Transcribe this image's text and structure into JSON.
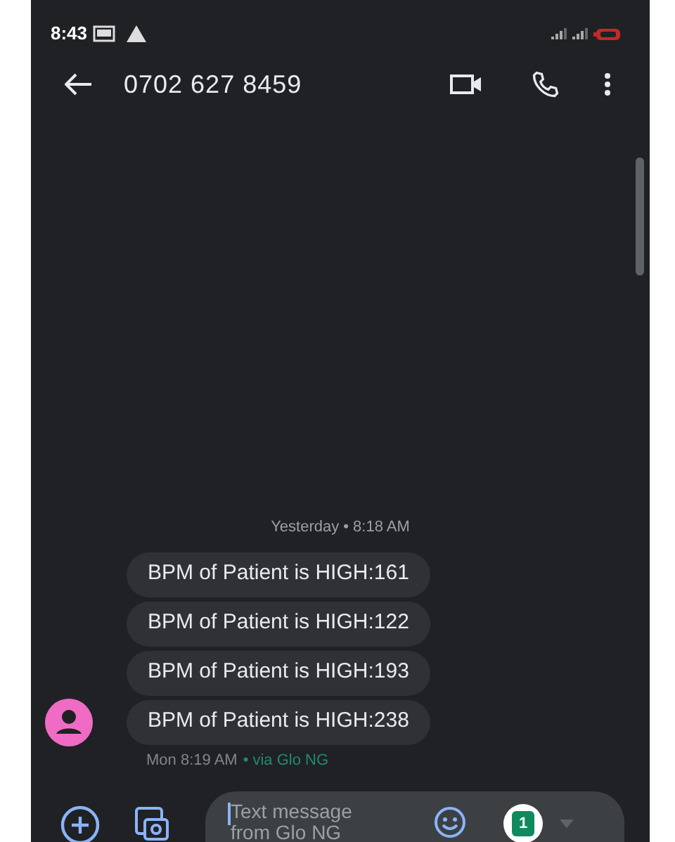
{
  "status_bar": {
    "time": "8:43"
  },
  "header": {
    "title": "0702 627 8459"
  },
  "conversation": {
    "date_divider": "Yesterday • 8:18 AM",
    "messages": [
      {
        "text": "BPM of Patient is HIGH:161"
      },
      {
        "text": "BPM of Patient is HIGH:122"
      },
      {
        "text": "BPM of Patient is HIGH:193"
      },
      {
        "text": "BPM of Patient is HIGH:238"
      }
    ],
    "footer_time": "Mon 8:19 AM",
    "footer_via": "• via Glo NG"
  },
  "composer": {
    "placeholder": "Text message from Glo NG",
    "sim": "1"
  }
}
